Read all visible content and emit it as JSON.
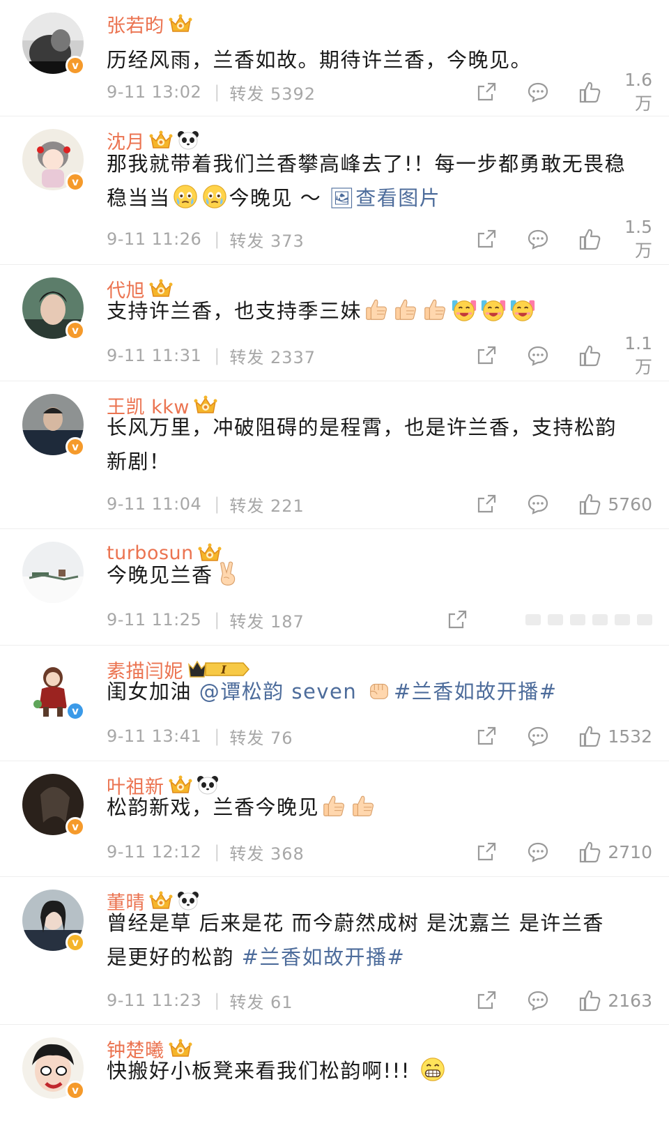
{
  "comments": [
    {
      "name": "张若昀",
      "text_parts": [
        {
          "t": "历经风雨，兰香如故。期待许兰香，今晚见。"
        }
      ],
      "time": "9-11 13:02",
      "repost": "转发 5392",
      "likes": "1.6万",
      "badges": [
        "crown"
      ],
      "verified": "orange"
    },
    {
      "name": "沈月",
      "text_parts": [
        {
          "t": "那我就带着我们兰香攀高峰去了!！每一步都勇敢无畏稳稳当当"
        },
        {
          "emoji": "teary"
        },
        {
          "emoji": "teary"
        },
        {
          "t": "今晚见 ～ "
        },
        {
          "link": "🖼查看图片"
        }
      ],
      "time": "9-11 11:26",
      "repost": "转发 373",
      "likes": "1.5万",
      "badges": [
        "crown",
        "panda"
      ],
      "verified": "orange"
    },
    {
      "name": "代旭",
      "text_parts": [
        {
          "t": "支持许兰香，也支持季三妹"
        },
        {
          "emoji": "thumb"
        },
        {
          "emoji": "thumb"
        },
        {
          "emoji": "thumb"
        },
        {
          "emoji": "cheer"
        },
        {
          "emoji": "cheer"
        },
        {
          "emoji": "cheer"
        }
      ],
      "time": "9-11 11:31",
      "repost": "转发 2337",
      "likes": "1.1万",
      "badges": [
        "crown"
      ],
      "verified": "orange"
    },
    {
      "name": "王凯 kkw",
      "text_parts": [
        {
          "t": "长风万里，冲破阻碍的是程霄，也是许兰香，支持松韵新剧！"
        }
      ],
      "time": "9-11 11:04",
      "repost": "转发 221",
      "likes": "5760",
      "badges": [
        "crown"
      ],
      "verified": "orange"
    },
    {
      "name": "turbosun",
      "text_parts": [
        {
          "t": "今晚见兰香"
        },
        {
          "emoji": "victory"
        }
      ],
      "time": "9-11 11:25",
      "repost": "转发 187",
      "likes": "",
      "badges": [
        "crown"
      ],
      "verified": "none",
      "blurred_actions": true
    },
    {
      "name": "素描闫妮",
      "text_parts": [
        {
          "t": "闺女加油 "
        },
        {
          "link": "@谭松韵 seven"
        },
        {
          "t": " "
        },
        {
          "emoji": "fist"
        },
        {
          "link": "#兰香如故开播#"
        }
      ],
      "time": "9-11 13:41",
      "repost": "转发 76",
      "likes": "1532",
      "badges": [
        "level"
      ],
      "level": "I",
      "verified": "blue"
    },
    {
      "name": "叶祖新",
      "text_parts": [
        {
          "t": "松韵新戏，兰香今晚见"
        },
        {
          "emoji": "thumb"
        },
        {
          "emoji": "thumb"
        }
      ],
      "time": "9-11 12:12",
      "repost": "转发 368",
      "likes": "2710",
      "badges": [
        "crown",
        "panda"
      ],
      "verified": "orange"
    },
    {
      "name": "董晴",
      "text_parts": [
        {
          "t": "曾经是草 后来是花 而今蔚然成树 是沈嘉兰 是许兰香是更好的松韵  "
        },
        {
          "link": "#兰香如故开播#"
        }
      ],
      "time": "9-11 11:23",
      "repost": "转发 61",
      "likes": "2163",
      "badges": [
        "crown",
        "panda"
      ],
      "verified": "gold"
    },
    {
      "name": "钟楚曦",
      "text_parts": [
        {
          "t": "快搬好小板凳来看我们松韵啊!!!  "
        },
        {
          "emoji": "grin"
        }
      ],
      "time": "",
      "repost": "",
      "likes": "",
      "badges": [
        "crown"
      ],
      "verified": "orange"
    }
  ],
  "colors": {
    "name": "#eb7350",
    "link": "#4d6c9b",
    "meta": "#a7a7a7"
  },
  "icons": [
    "share-icon",
    "comment-icon",
    "like-icon",
    "verified-icon",
    "crown-icon",
    "panda-icon"
  ]
}
